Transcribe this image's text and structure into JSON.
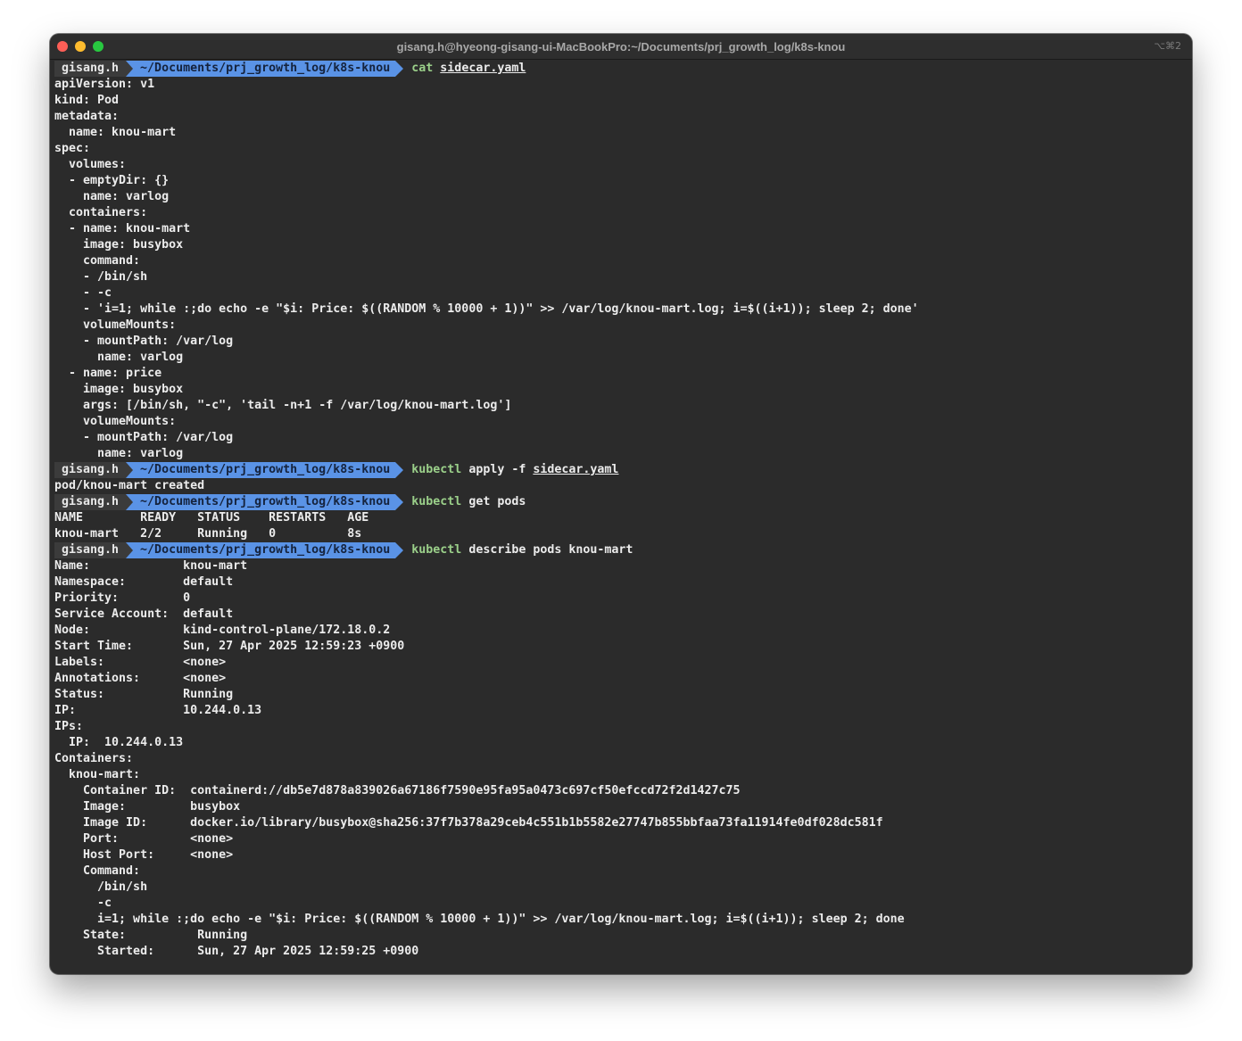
{
  "window": {
    "title": "gisang.h@hyeong-gisang-ui-MacBookPro:~/Documents/prj_growth_log/k8s-knou",
    "shortcut": "⌥⌘2"
  },
  "prompt": {
    "user": "gisang.h",
    "path": "~/Documents/prj_growth_log/k8s-knou"
  },
  "commands": {
    "cat": {
      "name": "cat",
      "args": "",
      "file": "sidecar.yaml"
    },
    "apply": {
      "name": "kubectl",
      "args": "apply -f ",
      "file": "sidecar.yaml"
    },
    "get": {
      "name": "kubectl",
      "args": "get pods",
      "file": ""
    },
    "describe": {
      "name": "kubectl",
      "args": "describe pods knou-mart",
      "file": ""
    }
  },
  "yaml_output": [
    "apiVersion: v1",
    "kind: Pod",
    "metadata:",
    "  name: knou-mart",
    "spec:",
    "  volumes:",
    "  - emptyDir: {}",
    "    name: varlog",
    "  containers:",
    "  - name: knou-mart",
    "    image: busybox",
    "    command:",
    "    - /bin/sh",
    "    - -c",
    "    - 'i=1; while :;do echo -e \"$i: Price: $((RANDOM % 10000 + 1))\" >> /var/log/knou-mart.log; i=$((i+1)); sleep 2; done'",
    "    volumeMounts:",
    "    - mountPath: /var/log",
    "      name: varlog",
    "  - name: price",
    "    image: busybox",
    "    args: [/bin/sh, \"-c\", 'tail -n+1 -f /var/log/knou-mart.log']",
    "    volumeMounts:",
    "    - mountPath: /var/log",
    "      name: varlog"
  ],
  "apply_output": [
    "pod/knou-mart created"
  ],
  "get_output": [
    "NAME        READY   STATUS    RESTARTS   AGE",
    "knou-mart   2/2     Running   0          8s"
  ],
  "describe_output": [
    "Name:             knou-mart",
    "Namespace:        default",
    "Priority:         0",
    "Service Account:  default",
    "Node:             kind-control-plane/172.18.0.2",
    "Start Time:       Sun, 27 Apr 2025 12:59:23 +0900",
    "Labels:           <none>",
    "Annotations:      <none>",
    "Status:           Running",
    "IP:               10.244.0.13",
    "IPs:",
    "  IP:  10.244.0.13",
    "Containers:",
    "  knou-mart:",
    "    Container ID:  containerd://db5e7d878a839026a67186f7590e95fa95a0473c697cf50efccd72f2d1427c75",
    "    Image:         busybox",
    "    Image ID:      docker.io/library/busybox@sha256:37f7b378a29ceb4c551b1b5582e27747b855bbfaa73fa11914fe0df028dc581f",
    "    Port:          <none>",
    "    Host Port:     <none>",
    "    Command:",
    "      /bin/sh",
    "      -c",
    "      i=1; while :;do echo -e \"$i: Price: $((RANDOM % 10000 + 1))\" >> /var/log/knou-mart.log; i=$((i+1)); sleep 2; done",
    "    State:          Running",
    "      Started:      Sun, 27 Apr 2025 12:59:25 +0900"
  ],
  "colors": {
    "background": "#2b2b2b",
    "prompt_user_bg": "#3b3b3b",
    "prompt_path_bg": "#5a93e6",
    "command_name": "#9bd08a",
    "text": "#ececec"
  }
}
